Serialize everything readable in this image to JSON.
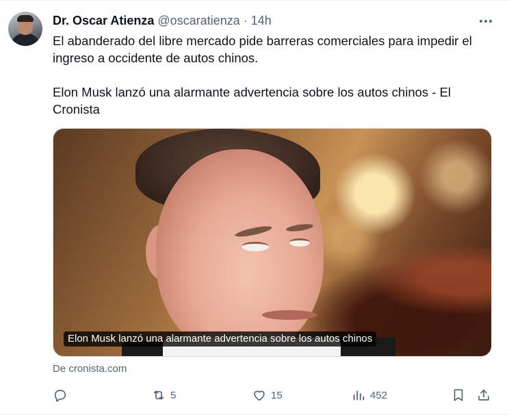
{
  "tweet": {
    "author_name": "Dr. Oscar Atienza",
    "author_handle": "@oscaratienza",
    "separator": "·",
    "time": "14h",
    "text_paragraphs": [
      "El abanderado del libre mercado pide barreras comerciales para impedir el ingreso a occidente de autos chinos.",
      "Elon Musk lanzó una alarmante advertencia sobre los autos chinos - El Cronista"
    ],
    "card": {
      "caption": "Elon Musk lanzó una alarmante advertencia sobre los autos chinos",
      "source": "De cronista.com"
    },
    "actions": {
      "reply_count": "",
      "retweet_count": "5",
      "like_count": "15",
      "views_count": "452"
    },
    "icons": {
      "more": "more-horizontal-icon",
      "reply": "reply-icon",
      "retweet": "retweet-icon",
      "like": "heart-icon",
      "views": "views-icon",
      "bookmark": "bookmark-icon",
      "share": "share-icon"
    },
    "colors": {
      "text": "#0f1419",
      "secondary": "#536471",
      "border": "#cfd9de"
    }
  }
}
